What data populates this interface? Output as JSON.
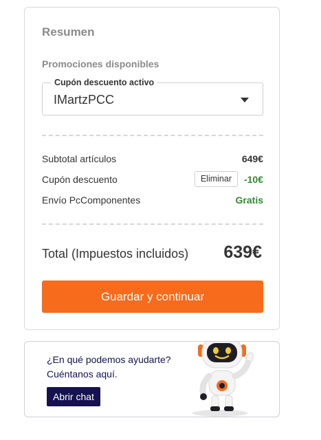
{
  "summary": {
    "title": "Resumen",
    "promotions_label": "Promociones disponibles",
    "coupon": {
      "legend": "Cupón descuento activo",
      "selected": "IMartzPCC"
    },
    "rows": [
      {
        "label": "Subtotal artículos",
        "value": "649€"
      },
      {
        "label": "Cupón descuento",
        "action": "Eliminar",
        "value": "-10€"
      },
      {
        "label": "Envío PcComponentes",
        "value": "Gratis"
      }
    ],
    "total": {
      "label": "Total (Impuestos incluidos)",
      "value": "639€"
    },
    "continue_label": "Guardar y continuar"
  },
  "help": {
    "line1": "¿En qué podemos ayudarte?",
    "line2": "Cuéntanos aquí.",
    "chat_label": "Abrir chat",
    "mascot_icon": "robot-mascot"
  },
  "colors": {
    "accent": "#f76b1c",
    "success": "#2f8a2f",
    "chat": "#15124f"
  }
}
